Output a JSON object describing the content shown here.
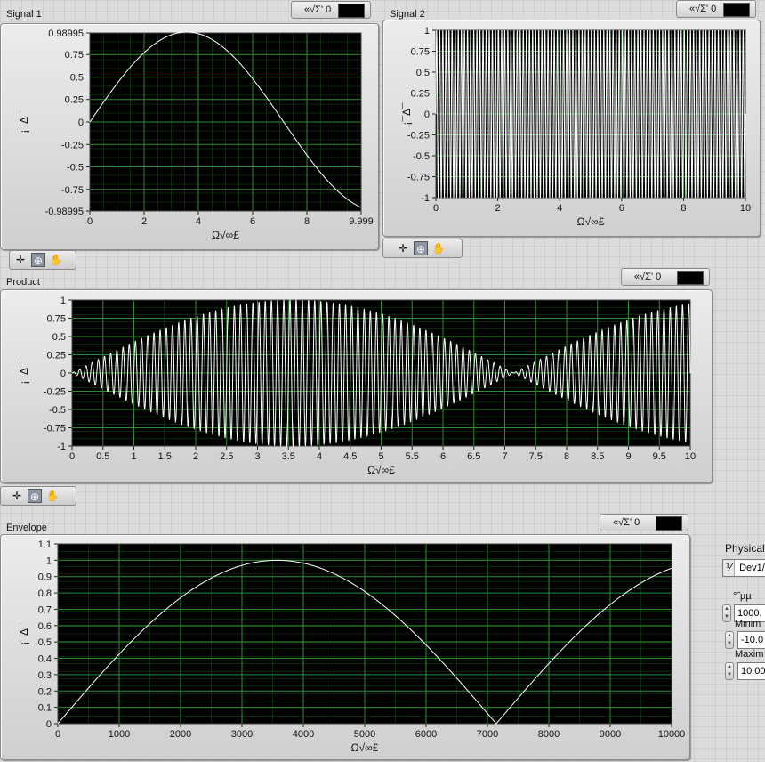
{
  "graphs": [
    {
      "id": "signal1",
      "label": "Signal 1",
      "legend": {
        "text": "«√Σ' 0"
      },
      "chart_data": {
        "type": "line",
        "title": "",
        "xlabel": "Ω√∞£",
        "ylabel": "¡¯Δ¯",
        "xlim": [
          0,
          9.999
        ],
        "ylim": [
          -0.98995,
          0.98995
        ],
        "x_ticks": [
          0,
          2,
          4,
          6,
          8,
          9.999
        ],
        "x_tick_labels": [
          "0",
          "2",
          "4",
          "6",
          "8",
          "9.999"
        ],
        "y_ticks": [
          0.98995,
          0.75,
          0.5,
          0.25,
          0,
          -0.25,
          -0.5,
          -0.75,
          -0.98995
        ],
        "y_tick_labels": [
          "0.98995",
          "0.75",
          "0.5",
          "0.25",
          "0",
          "-0.25",
          "-0.5",
          "-0.75",
          "-0.98995"
        ],
        "grid": true,
        "series": [
          {
            "formula": "sin(2*pi*0.07*x)",
            "x_range": [
              0,
              9.999
            ],
            "color": "#ffffff"
          }
        ]
      }
    },
    {
      "id": "signal2",
      "label": "Signal 2",
      "legend": {
        "text": "«√Σ' 0"
      },
      "chart_data": {
        "type": "line",
        "title": "",
        "xlabel": "Ω√∞£",
        "ylabel": "¡¯Δ¯",
        "xlim": [
          0,
          10
        ],
        "ylim": [
          -1,
          1
        ],
        "x_ticks": [
          0,
          2,
          4,
          6,
          8,
          10
        ],
        "x_tick_labels": [
          "0",
          "2",
          "4",
          "6",
          "8",
          "10"
        ],
        "y_ticks": [
          1,
          0.75,
          0.5,
          0.25,
          0,
          -0.25,
          -0.5,
          -0.75,
          -1
        ],
        "y_tick_labels": [
          "1",
          "0.75",
          "0.5",
          "0.25",
          "0",
          "-0.25",
          "-0.5",
          "-0.75",
          "-1"
        ],
        "grid": true,
        "series": [
          {
            "formula": "sin(2*pi*10*x)",
            "x_range": [
              0,
              10
            ],
            "color": "#ffffff"
          }
        ]
      }
    },
    {
      "id": "product",
      "label": "Product",
      "legend": {
        "text": "«√Σ' 0"
      },
      "chart_data": {
        "type": "line",
        "title": "",
        "xlabel": "Ω√∞£",
        "ylabel": "¡¯Δ¯",
        "xlim": [
          0,
          10
        ],
        "ylim": [
          -1,
          1
        ],
        "x_ticks": [
          0,
          0.5,
          1,
          1.5,
          2,
          2.5,
          3,
          3.5,
          4,
          4.5,
          5,
          5.5,
          6,
          6.5,
          7,
          7.5,
          8,
          8.5,
          9,
          9.5,
          10
        ],
        "x_tick_labels": [
          "0",
          "0.5",
          "1",
          "1.5",
          "2",
          "2.5",
          "3",
          "3.5",
          "4",
          "4.5",
          "5",
          "5.5",
          "6",
          "6.5",
          "7",
          "7.5",
          "8",
          "8.5",
          "9",
          "9.5",
          "10"
        ],
        "y_ticks": [
          1,
          0.75,
          0.5,
          0.25,
          0,
          -0.25,
          -0.5,
          -0.75,
          -1
        ],
        "y_tick_labels": [
          "1",
          "0.75",
          "0.5",
          "0.25",
          "0",
          "-0.25",
          "-0.5",
          "-0.75",
          "-1"
        ],
        "grid": true,
        "series": [
          {
            "formula": "sin(2*pi*0.07*x) * sin(2*pi*10*x)",
            "x_range": [
              0,
              10
            ],
            "color": "#ffffff"
          }
        ]
      }
    },
    {
      "id": "envelope",
      "label": "Envelope",
      "legend": {
        "text": "«√Σ' 0"
      },
      "chart_data": {
        "type": "line",
        "title": "",
        "xlabel": "Ω√∞£",
        "ylabel": "¡¯Δ¯",
        "xlim": [
          0,
          10000
        ],
        "ylim": [
          0,
          1.1
        ],
        "x_ticks": [
          0,
          1000,
          2000,
          3000,
          4000,
          5000,
          6000,
          7000,
          8000,
          9000,
          10000
        ],
        "x_tick_labels": [
          "0",
          "1000",
          "2000",
          "3000",
          "4000",
          "5000",
          "6000",
          "7000",
          "8000",
          "9000",
          "10000"
        ],
        "y_ticks": [
          1.1,
          1,
          0.9,
          0.8,
          0.7,
          0.6,
          0.5,
          0.4,
          0.3,
          0.2,
          0.1,
          0
        ],
        "y_tick_labels": [
          "1.1",
          "1",
          "0.9",
          "0.8",
          "0.7",
          "0.6",
          "0.5",
          "0.4",
          "0.3",
          "0.2",
          "0.1",
          "0"
        ],
        "grid": true,
        "series": [
          {
            "formula": "|sin(2*pi*0.00007*x)|",
            "x_range": [
              0,
              10000
            ],
            "color": "#ffffff"
          }
        ]
      }
    }
  ],
  "palette_tools": [
    {
      "name": "cursor-move-tool",
      "glyph": "✛"
    },
    {
      "name": "zoom-tool",
      "glyph": "⊕"
    },
    {
      "name": "pan-tool",
      "glyph": "✋"
    }
  ],
  "side_panel": {
    "physical_label": "Physical",
    "physical_value": "Dev1/",
    "physical_glyph": "⅟",
    "rate_label": "°˝µµ",
    "rate_value": "1000.",
    "minimum_label": "Minim",
    "minimum_value": "-10.0",
    "maximum_label": "Maxim",
    "maximum_value": "10.00"
  },
  "colors": {
    "plot_bg": "#000000",
    "grid": "#2e8b2e",
    "trace": "#ffffff",
    "panel_bg": "#dcdcdc"
  }
}
